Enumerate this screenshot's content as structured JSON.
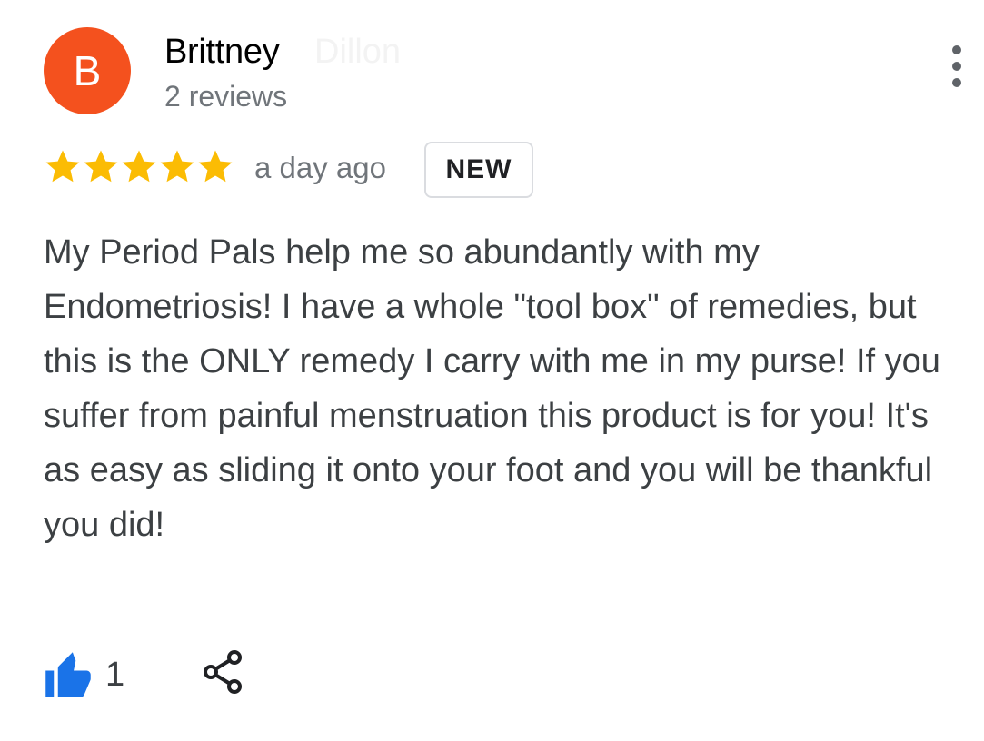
{
  "reviewer": {
    "initial": "B",
    "name": "Brittney",
    "name_faded": "Dillon",
    "review_count": "2 reviews",
    "avatar_color": "#f4511e"
  },
  "review": {
    "rating": 5,
    "rating_max": 5,
    "star_color": "#fbbc04",
    "timestamp": "a day ago",
    "badge": "NEW",
    "text": "My Period Pals help me so abundantly with my Endometriosis! I have a whole \"tool box\" of remedies, but this is the ONLY remedy I carry with me in my purse! If you suffer from painful menstruation this product is for you! It's as easy as sliding it onto your foot and you will be thankful you did!"
  },
  "actions": {
    "like_count": "1",
    "like_color": "#1a73e8",
    "like_icon": "thumbs-up-icon",
    "share_icon": "share-icon",
    "menu_icon": "more-vert-icon"
  }
}
